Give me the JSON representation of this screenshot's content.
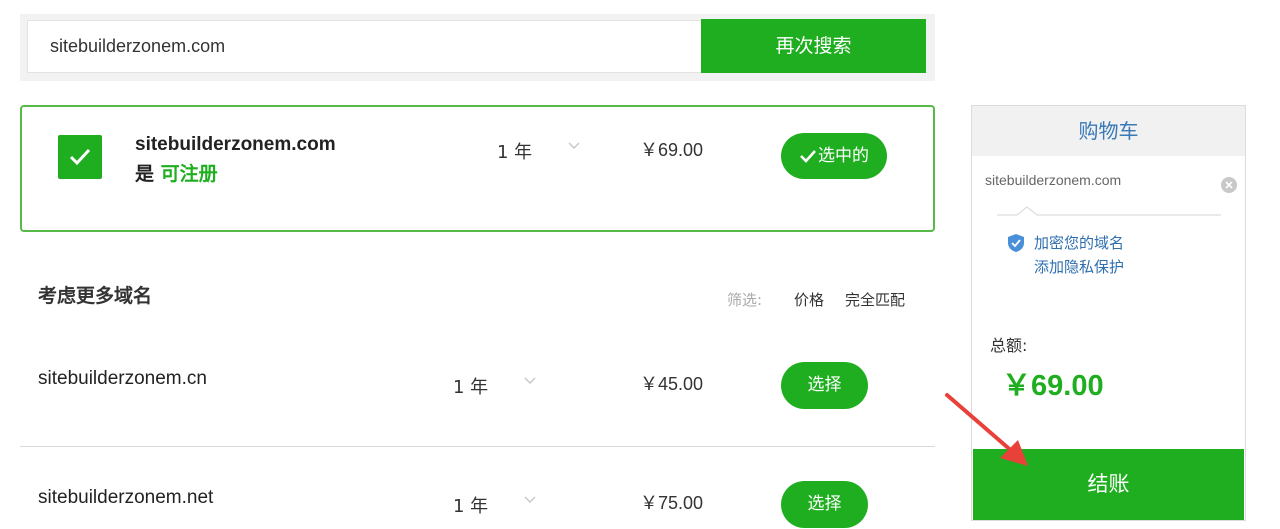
{
  "search": {
    "value": "sitebuilderzonem.com",
    "button_label": "再次搜索"
  },
  "selected": {
    "domain": "sitebuilderzonem.com",
    "status_prefix": "是",
    "status": "可注册",
    "term": "1 年",
    "price": "￥69.00",
    "button_label": "选中的"
  },
  "more": {
    "title": "考虑更多域名",
    "filter_label": "筛选:",
    "filter_options": [
      "价格",
      "完全匹配"
    ],
    "rows": [
      {
        "domain": "sitebuilderzonem.cn",
        "term": "1 年",
        "price": "￥45.00",
        "button_label": "选择"
      },
      {
        "domain": "sitebuilderzonem.net",
        "term": "1 年",
        "price": "￥75.00",
        "button_label": "选择"
      }
    ]
  },
  "cart": {
    "title": "购物车",
    "item": "sitebuilderzonem.com",
    "privacy_line1": "加密您的域名",
    "privacy_line2": "添加隐私保护",
    "total_label": "总额:",
    "total": "￥69.00",
    "checkout_label": "结账"
  },
  "colors": {
    "accent": "#1fae1f",
    "link": "#2e6faf",
    "arrow": "#e8413a"
  },
  "icons": [
    "check-icon",
    "chevron-down-icon",
    "close-icon",
    "shield-icon",
    "arrow-pointer-icon"
  ]
}
